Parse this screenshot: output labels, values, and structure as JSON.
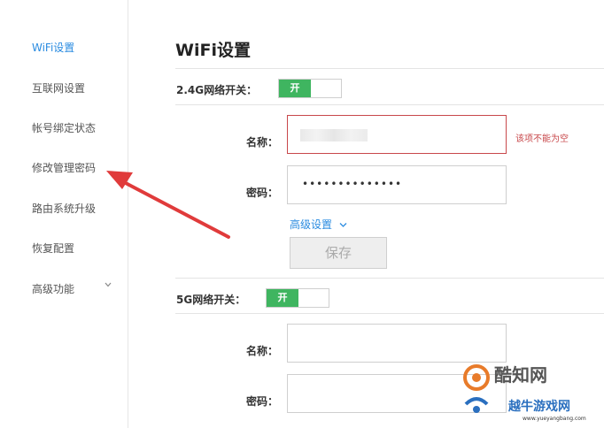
{
  "sidebar": {
    "items": [
      {
        "label": "WiFi设置",
        "active": true
      },
      {
        "label": "互联网设置"
      },
      {
        "label": "帐号绑定状态"
      },
      {
        "label": "修改管理密码"
      },
      {
        "label": "路由系统升级"
      },
      {
        "label": "恢复配置"
      },
      {
        "label": "高级功能"
      }
    ]
  },
  "main": {
    "title": "WiFi设置",
    "band24": {
      "switch_label": "2.4G网络开关：",
      "switch_state": "开",
      "name_label": "名称：",
      "name_value": "",
      "name_error": "该项不能为空",
      "password_label": "密码：",
      "password_value": "••••••••••••••",
      "advanced_label": "高级设置",
      "save_label": "保存"
    },
    "band5": {
      "switch_label": "5G网络开关：",
      "switch_state": "开",
      "name_label": "名称：",
      "password_label": "密码："
    }
  },
  "watermark": {
    "brand": "酷知网",
    "brand2": "越牛游戏网",
    "url": "www.yueyangbang.com"
  },
  "colors": {
    "accent": "#2a8be0",
    "switch_on": "#3fb560",
    "error": "#c8484b",
    "annotation_arrow": "#e03b3b"
  }
}
